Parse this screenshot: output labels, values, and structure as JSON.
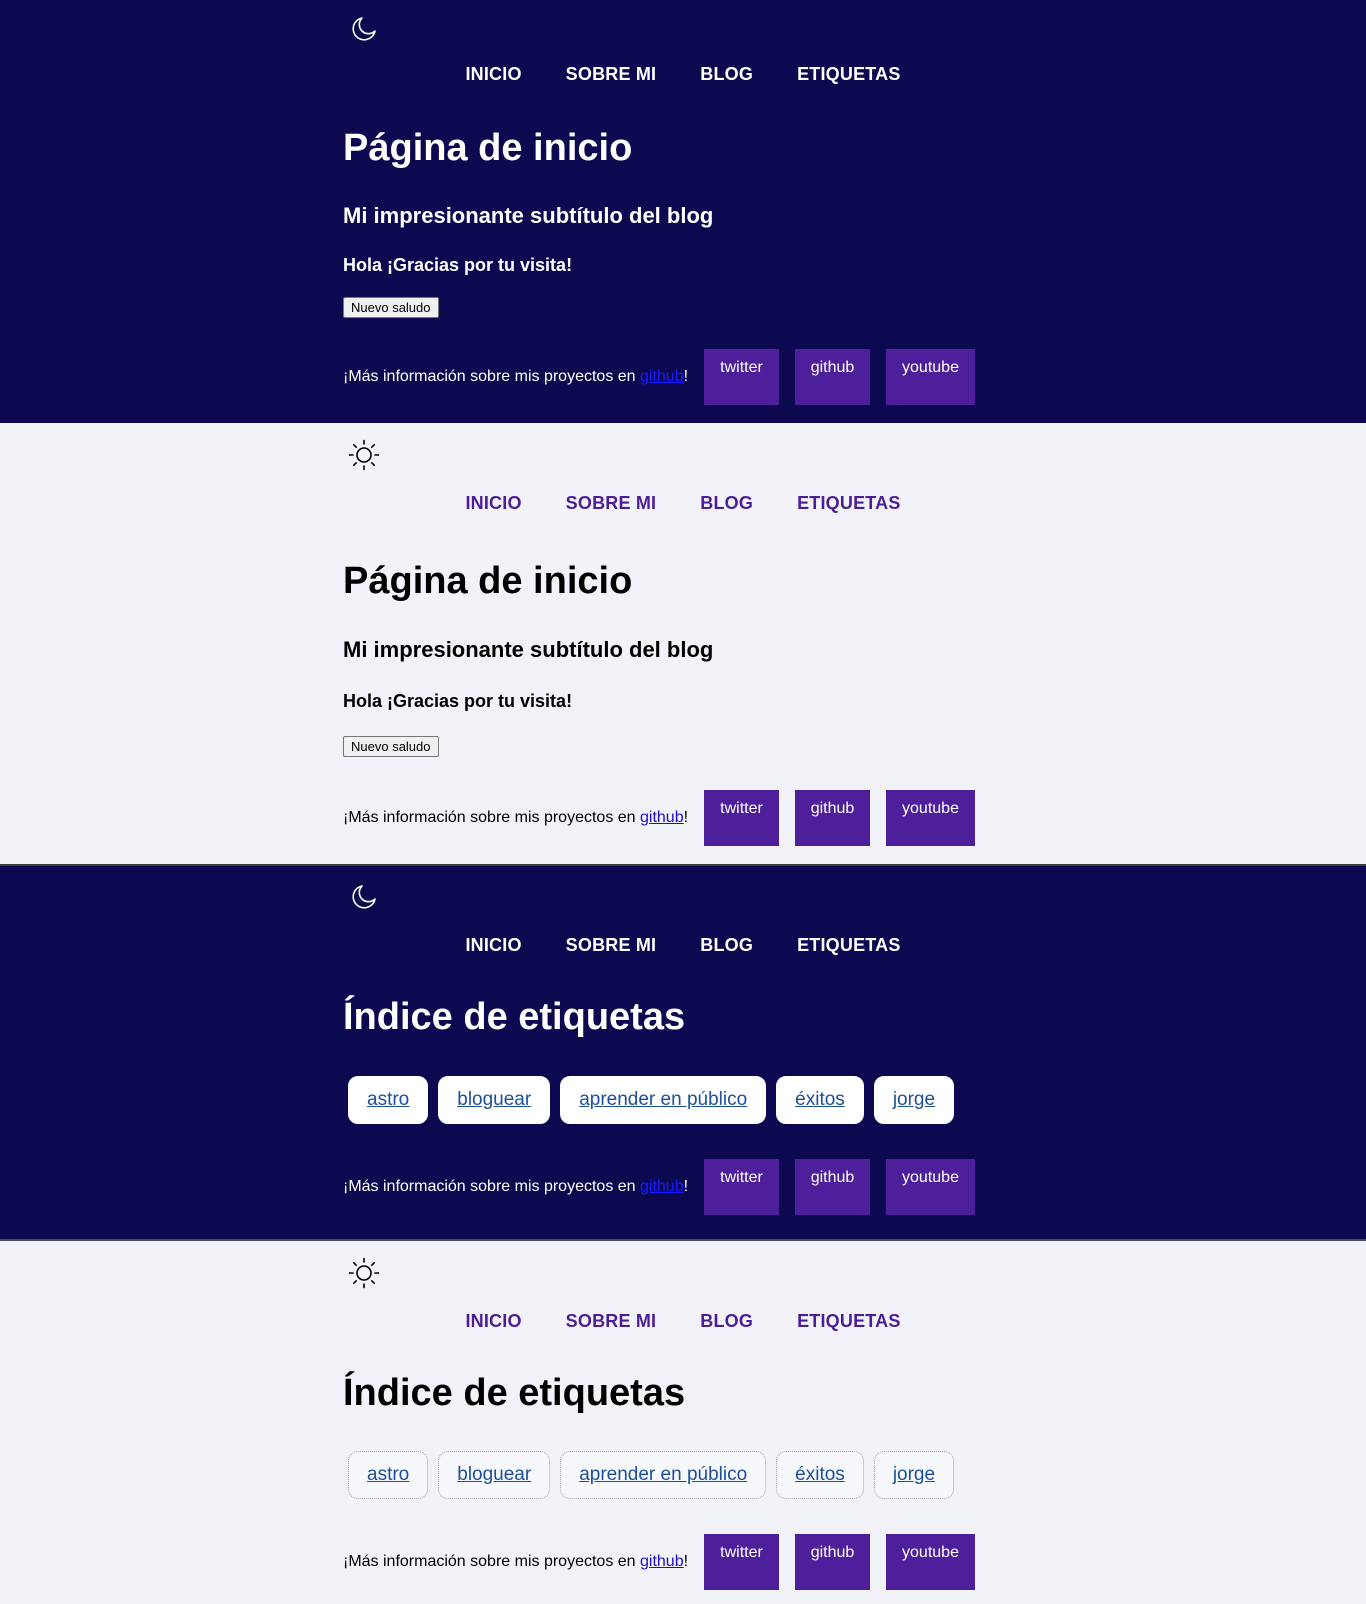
{
  "colors": {
    "dark_bg": "#0d0950",
    "light_bg": "#f1f3f8",
    "accent_purple": "#4d1f9b",
    "light_nav_link": "#4c1d95"
  },
  "nav": {
    "home": "INICIO",
    "about": "SOBRE MI",
    "blog": "BLOG",
    "tags": "ETIQUETAS"
  },
  "home": {
    "title": "Página de inicio",
    "subtitle": "Mi impresionante subtítulo del blog",
    "greeting": "Hola ¡Gracias por tu visita!",
    "button_label": "Nuevo saludo"
  },
  "tags_page": {
    "title": "Índice de etiquetas",
    "tags": [
      "astro",
      "bloguear",
      "aprender en público",
      "éxitos",
      "jorge"
    ]
  },
  "footer": {
    "text_before": "¡Más información sobre mis proyectos en ",
    "link": "github",
    "text_after": "!",
    "social": {
      "twitter": "twitter",
      "github": "github",
      "youtube": "youtube"
    }
  },
  "theme_toggle": {
    "dark_icon": "moon-icon",
    "light_icon": "sun-icon"
  }
}
